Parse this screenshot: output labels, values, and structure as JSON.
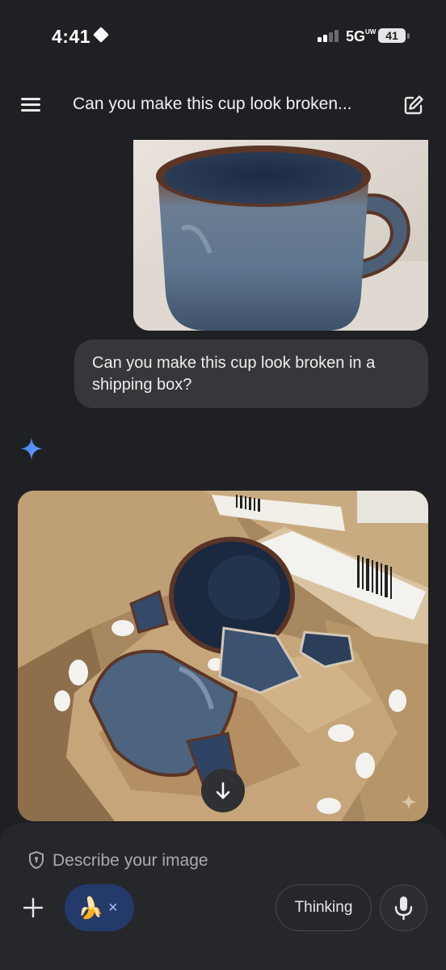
{
  "status": {
    "time": "4:41",
    "network": "5G",
    "network_sup": "UW",
    "battery": "41"
  },
  "header": {
    "title": "Can you make this cup look broken..."
  },
  "chat": {
    "user_message": "Can you make this cup look broken in a shipping box?"
  },
  "composer": {
    "placeholder": "Describe your image",
    "chip_emoji": "🍌",
    "chip_close": "×",
    "thinking_label": "Thinking"
  },
  "colors": {
    "accent_blue": "#4a8cf7",
    "chip_bg": "#233a6b",
    "background": "#1f2023"
  },
  "icons": [
    "menu-icon",
    "edit-icon",
    "gemini-sparkle-icon",
    "arrow-down-icon",
    "shield-icon",
    "plus-icon",
    "microphone-icon"
  ]
}
